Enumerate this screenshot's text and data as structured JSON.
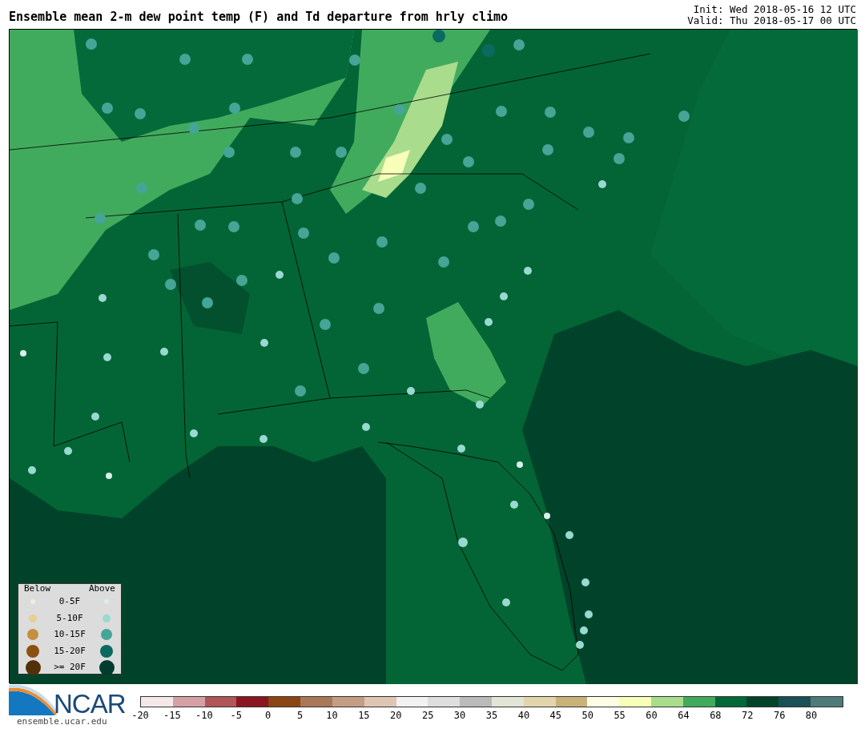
{
  "title": "Ensemble mean 2-m dew point temp (F) and Td departure from hrly climo",
  "init": "Init: Wed 2018-05-16 12 UTC",
  "valid": "Valid: Thu 2018-05-17 00 UTC",
  "legend": {
    "below_header": "Below",
    "above_header": "Above",
    "rows": [
      {
        "label": "0-5F",
        "below": {
          "color": "#f5ecd9"
        },
        "above": {
          "color": "#d8efec"
        }
      },
      {
        "label": "5-10F",
        "below": {
          "color": "#e8cf92"
        },
        "above": {
          "color": "#98d9d0"
        }
      },
      {
        "label": "10-15F",
        "below": {
          "color": "#c68e3f"
        },
        "above": {
          "color": "#45a596"
        }
      },
      {
        "label": "15-20F",
        "below": {
          "color": "#8a510f"
        },
        "above": {
          "color": "#0a6a60"
        }
      },
      {
        "label": ">= 20F",
        "below": {
          "color": "#532f08"
        },
        "above": {
          "color": "#023c30"
        }
      }
    ]
  },
  "logo": {
    "text": "NCAR",
    "url": "ensemble.ucar.edu"
  },
  "colorbar": {
    "segments": [
      {
        "color": "#f5e8e8"
      },
      {
        "color": "#d4a0a4"
      },
      {
        "color": "#b05558"
      },
      {
        "color": "#8b1520"
      },
      {
        "color": "#8b4513"
      },
      {
        "color": "#a97857"
      },
      {
        "color": "#c39e84"
      },
      {
        "color": "#dec5b4"
      },
      {
        "color": "#f2f2f2"
      },
      {
        "color": "#dedede"
      },
      {
        "color": "#bababa"
      },
      {
        "color": "#e2e4d6"
      },
      {
        "color": "#e2d5ac"
      },
      {
        "color": "#c8b278"
      },
      {
        "color": "#fdfde5"
      },
      {
        "color": "#f7ffb8"
      },
      {
        "color": "#a9dc8c"
      },
      {
        "color": "#41ab5d"
      },
      {
        "color": "#006837"
      },
      {
        "color": "#00432a"
      },
      {
        "color": "#1a4f55"
      },
      {
        "color": "#4e7a7a"
      }
    ],
    "ticks": [
      "-20",
      "-15",
      "-10",
      "-5",
      "0",
      "5",
      "10",
      "15",
      "20",
      "25",
      "30",
      "35",
      "40",
      "45",
      "50",
      "55",
      "60",
      "64",
      "68",
      "72",
      "76",
      "80"
    ]
  }
}
